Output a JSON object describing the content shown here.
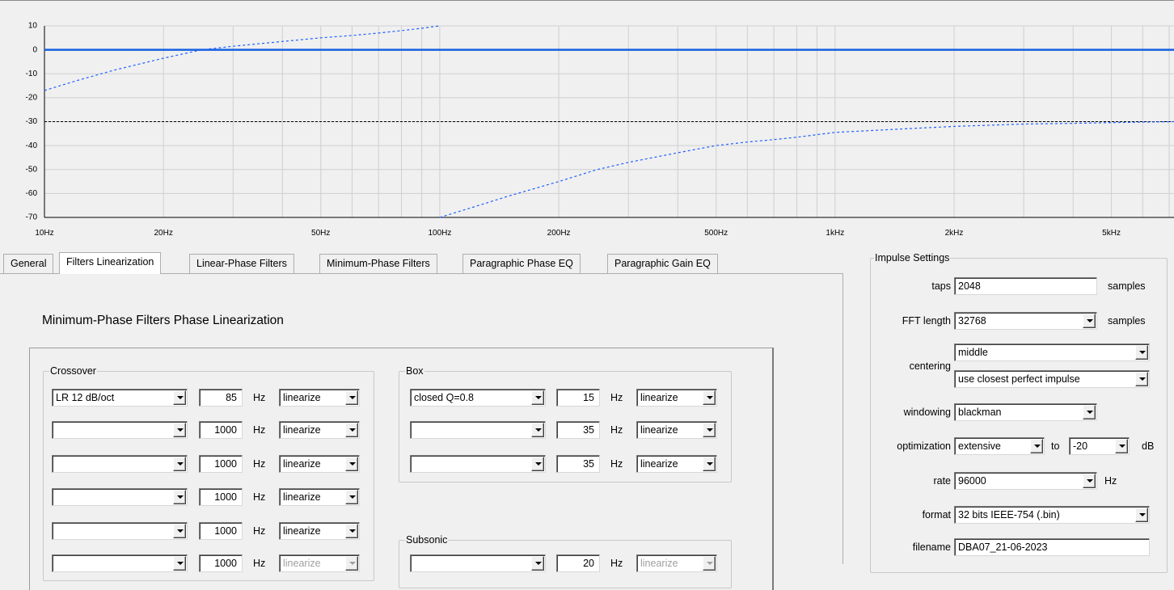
{
  "chart_data": {
    "type": "line",
    "xscale": "log",
    "xlim": [
      10,
      7200
    ],
    "ylim": [
      -70,
      10
    ],
    "yticks": [
      10,
      0,
      -10,
      -20,
      -30,
      -40,
      -50,
      -60,
      -70
    ],
    "xticks": [
      {
        "v": 10,
        "label": "10Hz"
      },
      {
        "v": 20,
        "label": "20Hz"
      },
      {
        "v": 50,
        "label": "50Hz"
      },
      {
        "v": 100,
        "label": "100Hz"
      },
      {
        "v": 200,
        "label": "200Hz"
      },
      {
        "v": 500,
        "label": "500Hz"
      },
      {
        "v": 1000,
        "label": "1kHz"
      },
      {
        "v": 2000,
        "label": "2kHz"
      },
      {
        "v": 5000,
        "label": "5kHz"
      }
    ],
    "grid": true,
    "series": [
      {
        "style": "solid",
        "color": "#1560e0",
        "x": [
          10,
          7200
        ],
        "y": [
          0,
          0
        ]
      },
      {
        "style": "dashed",
        "color": "#000000",
        "x": [
          10,
          7200
        ],
        "y": [
          -30,
          -30
        ]
      },
      {
        "style": "dotted",
        "color": "#1f5fff",
        "x": [
          10,
          12,
          15,
          20,
          25,
          30,
          40,
          50,
          60,
          70,
          80,
          90,
          100
        ],
        "y": [
          -17,
          -13,
          -8.5,
          -3.5,
          0,
          1.5,
          3.5,
          5,
          6,
          7,
          8,
          9,
          10
        ]
      },
      {
        "style": "dotted",
        "color": "#1f5fff",
        "x": [
          100,
          120,
          150,
          200,
          250,
          300,
          400,
          500,
          600,
          700,
          800,
          1000,
          1500,
          2000,
          3000,
          4000,
          5000,
          7200
        ],
        "y": [
          -70,
          -66,
          -61,
          -55,
          -50,
          -47,
          -43,
          -40,
          -38.5,
          -37.5,
          -36.5,
          -34.5,
          -33,
          -32,
          -31,
          -30.7,
          -30.4,
          -30
        ]
      }
    ]
  },
  "tabs": [
    {
      "label": "General",
      "active": false
    },
    {
      "label": "Filters Linearization",
      "active": true
    },
    {
      "label": "Linear-Phase Filters",
      "active": false
    },
    {
      "label": "Minimum-Phase Filters",
      "active": false
    },
    {
      "label": "Paragraphic Phase EQ",
      "active": false
    },
    {
      "label": "Paragraphic Gain EQ",
      "active": false
    }
  ],
  "section_title": "Minimum-Phase Filters Phase Linearization",
  "crossover": {
    "label": "Crossover",
    "unit": "Hz",
    "rows": [
      {
        "type": "LR  12 dB/oct",
        "freq": "85",
        "mode": "linearize"
      },
      {
        "type": "",
        "freq": "1000",
        "mode": "linearize"
      },
      {
        "type": "",
        "freq": "1000",
        "mode": "linearize"
      },
      {
        "type": "",
        "freq": "1000",
        "mode": "linearize"
      },
      {
        "type": "",
        "freq": "1000",
        "mode": "linearize"
      },
      {
        "type": "",
        "freq": "1000",
        "mode": "linearize"
      }
    ]
  },
  "box": {
    "label": "Box",
    "unit": "Hz",
    "rows": [
      {
        "type": "closed Q=0.8",
        "freq": "15",
        "mode": "linearize"
      },
      {
        "type": "",
        "freq": "35",
        "mode": "linearize"
      },
      {
        "type": "",
        "freq": "35",
        "mode": "linearize"
      }
    ]
  },
  "subsonic": {
    "label": "Subsonic",
    "unit": "Hz",
    "rows": [
      {
        "type": "",
        "freq": "20",
        "mode": "linearize"
      }
    ]
  },
  "impulse": {
    "title": "Impulse Settings",
    "taps_label": "taps",
    "taps_value": "2048",
    "taps_unit": "samples",
    "fft_label": "FFT length",
    "fft_value": "32768",
    "fft_unit": "samples",
    "centering_label": "centering",
    "centering_value1": "middle",
    "centering_value2": "use closest perfect impulse",
    "windowing_label": "windowing",
    "windowing_value": "blackman",
    "optimization_label": "optimization",
    "optimization_value": "extensive",
    "optimization_to": "to",
    "optimization_db": "-20",
    "optimization_db_unit": "dB",
    "rate_label": "rate",
    "rate_value": "96000",
    "rate_unit": "Hz",
    "format_label": "format",
    "format_value": "32 bits IEEE-754 (.bin)",
    "filename_label": "filename",
    "filename_value": "DBA07_21-06-2023"
  }
}
